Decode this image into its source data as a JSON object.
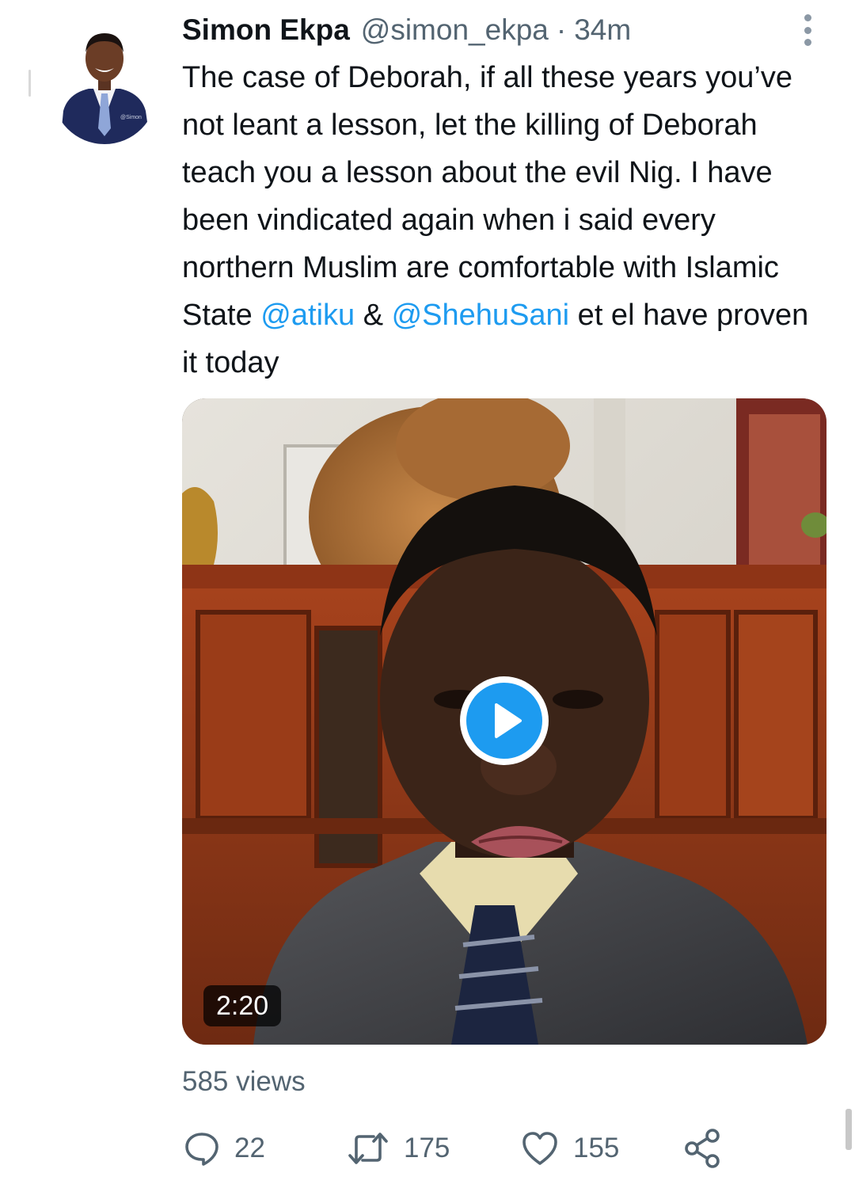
{
  "tweet": {
    "author": {
      "display_name": "Simon Ekpa",
      "handle": "@simon_ekpa"
    },
    "separator": "·",
    "timestamp": "34m",
    "text": {
      "part1": "The case of Deborah, if all these years you’ve not leant a lesson, let the killing of Deborah teach you a lesson about the evil Nig. I have been vindicated again when i said every northern Muslim are comfortable with Islamic State ",
      "mention1": "@atiku",
      "part2": " & ",
      "mention2": "@ShehuSani",
      "part3": " et el have proven it today"
    },
    "media": {
      "type": "video",
      "duration": "2:20"
    },
    "views": "585 views",
    "actions": {
      "reply": {
        "icon": "reply-icon",
        "count": "22"
      },
      "retweet": {
        "icon": "retweet-icon",
        "count": "175"
      },
      "like": {
        "icon": "heart-icon",
        "count": "155"
      },
      "share": {
        "icon": "share-icon"
      }
    }
  },
  "colors": {
    "link": "#1d9bf0",
    "secondary_text": "#536471",
    "primary_text": "#0f1419"
  }
}
